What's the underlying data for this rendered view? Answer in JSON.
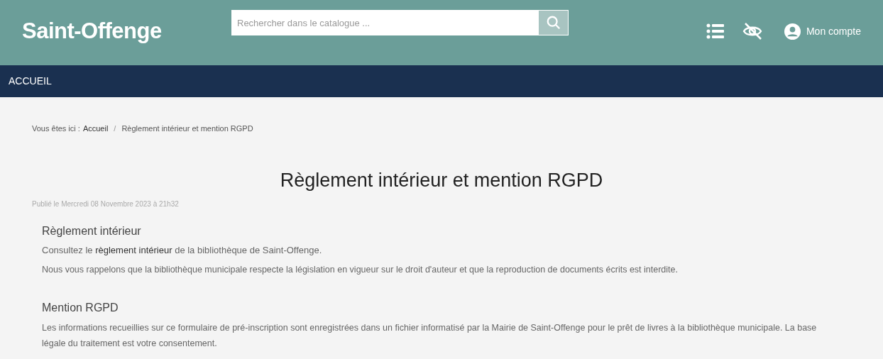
{
  "header": {
    "logo": "Saint-Offenge",
    "search": {
      "placeholder": "Rechercher dans le catalogue ..."
    },
    "account": "Mon compte"
  },
  "nav": [
    {
      "label": "ACCUEIL"
    }
  ],
  "breadcrumb": {
    "prefix": "Vous êtes ici :",
    "separator": "/",
    "items": [
      "Accueil",
      "Règlement intérieur et mention RGPD"
    ]
  },
  "article": {
    "title": "Règlement intérieur et mention RGPD",
    "published": "Publié le Mercredi 08 Novembre 2023 à 21h32",
    "sections": [
      {
        "heading": "Règlement intérieur",
        "paragraphs": [
          {
            "before": "Consultez le ",
            "link": "règlement intérieur",
            "after": " de la bibliothèque de Saint-Offenge."
          },
          {
            "text": "Nous vous rappelons que la bibliothèque municipale respecte la législation en vigueur sur le droit d'auteur et que la reproduction de documents écrits est interdite."
          }
        ]
      },
      {
        "heading": "Mention RGPD",
        "paragraphs": [
          {
            "text": "Les informations recueillies sur ce formulaire de pré-inscription sont enregistrées dans un fichier informatisé par la Mairie de Saint-Offenge pour le prêt de livres à la bibliothèque municipale. La base légale du traitement est votre consentement."
          }
        ]
      }
    ]
  }
}
